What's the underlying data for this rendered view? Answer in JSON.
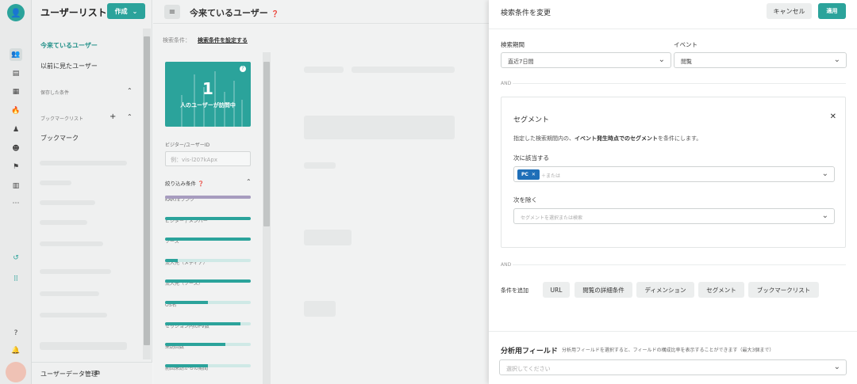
{
  "sidebar": {
    "title": "ユーザーリスト",
    "create_label": "作成",
    "items": [
      {
        "label": "今来ているユーザー"
      },
      {
        "label": "以前に見たユーザー"
      }
    ],
    "saved_conditions_label": "保存した条件",
    "bookmark_list_label": "ブックマークリスト",
    "bookmark_label": "ブックマーク",
    "footer_label": "ユーザーデータ管理"
  },
  "main": {
    "title": "今来ているユーザー",
    "condition_label": "検索条件：",
    "condition_link": "検索条件を設定する",
    "count": "1",
    "count_caption": "人のユーザーが訪問中",
    "visitor_id_label": "ビジター/ユーザーID",
    "visitor_id_placeholder": "例：vis-l207kApx",
    "filter_header": "絞り込み条件",
    "filters": [
      {
        "label": "KARTEランク",
        "fill": 1.0
      },
      {
        "label": "ビジター / メンバー",
        "fill": 1.0
      },
      {
        "label": "ソース",
        "fill": 1.0
      },
      {
        "label": "流入元（メディア）",
        "fill": 0.15
      },
      {
        "label": "流入元（ソース）",
        "fill": 1.0
      },
      {
        "label": "OS名",
        "fill": 0.5
      },
      {
        "label": "セッション内のPV数",
        "fill": 0.88
      },
      {
        "label": "来訪回数",
        "fill": 0.7
      },
      {
        "label": "前回来訪からの期間",
        "fill": 0.5
      }
    ]
  },
  "panel": {
    "title": "検索条件を変更",
    "cancel_label": "キャンセル",
    "apply_label": "適用",
    "period_label": "検索期間",
    "period_value": "直近7日間",
    "event_label": "イベント",
    "event_value": "閲覧",
    "and_label": "AND",
    "segment": {
      "title": "セグメント",
      "desc_pre": "指定した検索期間内の、",
      "desc_bold": "イベント発生時点でのセグメント",
      "desc_post": "を条件にします。",
      "match_label": "次に該当する",
      "tag": "PC",
      "or_placeholder": "＋または",
      "exclude_label": "次を除く",
      "exclude_placeholder": "セグメントを選択または検索"
    },
    "add_condition_label": "条件を追加",
    "add_buttons": [
      "URL",
      "閲覧の詳細条件",
      "ディメンション",
      "セグメント",
      "ブックマークリスト"
    ],
    "analysis_title": "分析用フィールド",
    "analysis_desc": "分析用フィールドを選択すると、フィールドの構成比率を表示することができます（最大3個まで）",
    "analysis_placeholder": "選択してください"
  }
}
